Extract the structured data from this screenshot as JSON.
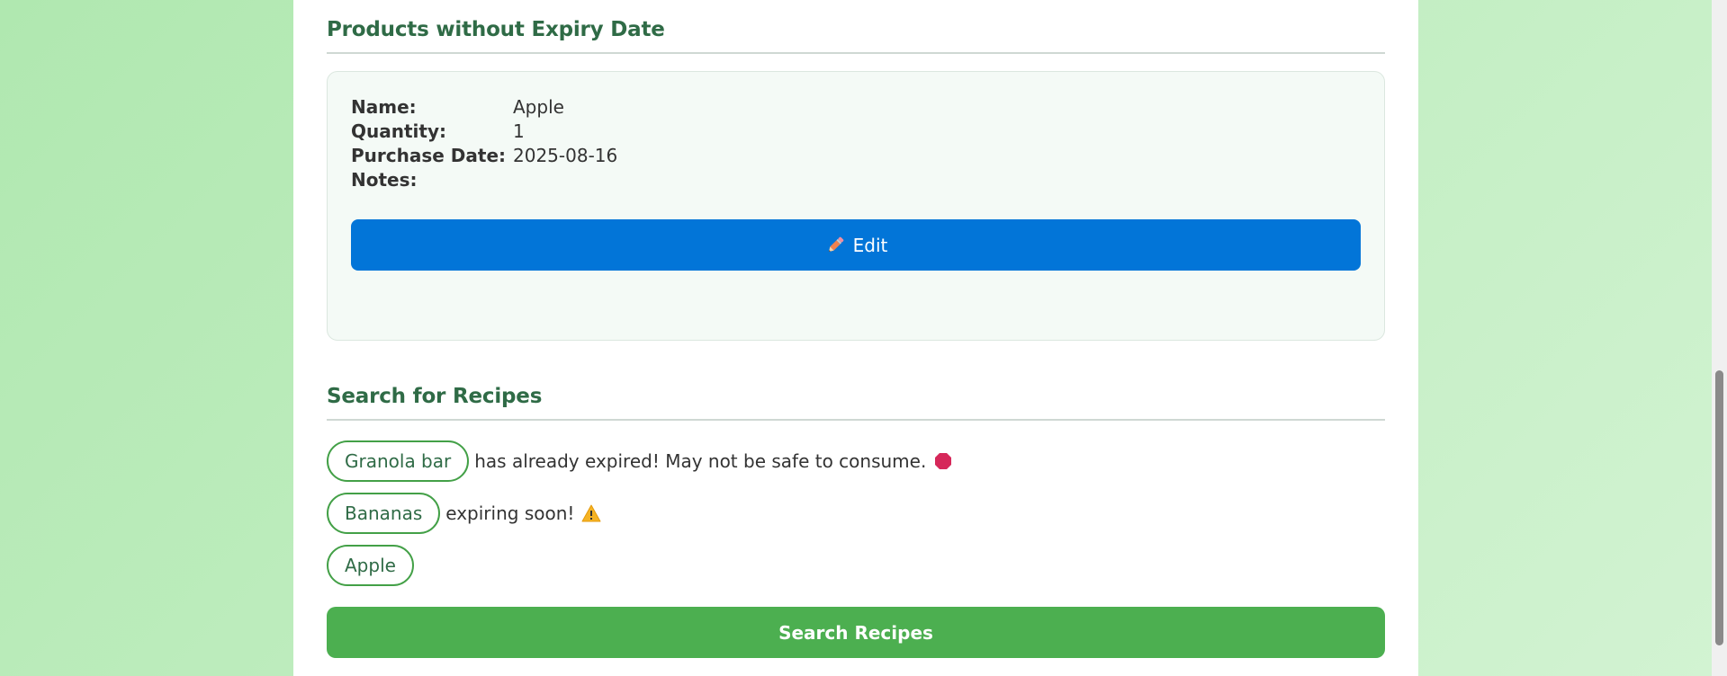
{
  "sections": {
    "no_expiry": {
      "title": "Products without Expiry Date",
      "product": {
        "fields": [
          {
            "label": "Name:",
            "value": "Apple"
          },
          {
            "label": "Quantity:",
            "value": "1"
          },
          {
            "label": "Purchase Date:",
            "value": "2025-08-16"
          },
          {
            "label": "Notes:",
            "value": ""
          }
        ],
        "edit_label": "Edit",
        "edit_icon": "pencil-icon"
      }
    },
    "recipes": {
      "title": "Search for Recipes",
      "items": [
        {
          "name": "Granola bar",
          "message": "has already expired! May not be safe to consume.",
          "status_icon": "red-stop-icon",
          "status_color": "#d6285a"
        },
        {
          "name": "Bananas",
          "message": "expiring soon!",
          "status_icon": "warning-icon",
          "status_color": "#f5b324"
        },
        {
          "name": "Apple",
          "message": "",
          "status_icon": "",
          "status_color": ""
        }
      ],
      "search_label": "Search Recipes"
    }
  },
  "colors": {
    "accent_blue": "#0275d8",
    "accent_green": "#4caf50",
    "heading_green": "#2f6b46"
  }
}
